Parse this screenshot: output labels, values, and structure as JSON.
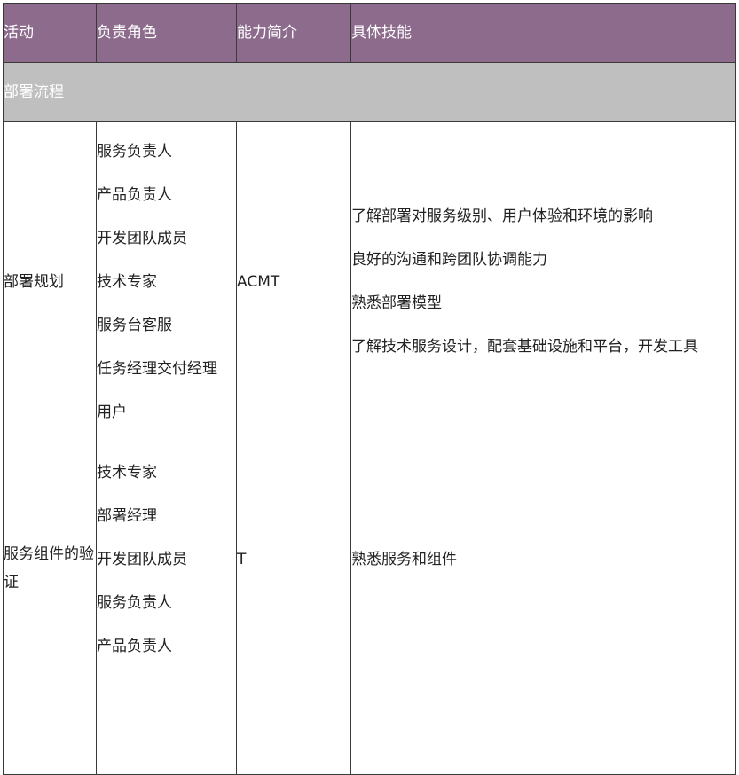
{
  "table": {
    "headers": [
      "活动",
      "负责角色",
      "能力简介",
      "具体技能"
    ],
    "section": "部署流程",
    "rows": [
      {
        "activity": "部署规划",
        "roles": [
          "服务负责人",
          "产品负责人",
          "开发团队成员",
          "技术专家",
          "服务台客服",
          "任务经理交付经理",
          "用户"
        ],
        "competency": "ACMT",
        "skills": [
          "了解部署对服务级别、用户体验和环境的影响",
          "良好的沟通和跨团队协调能力",
          "熟悉部署模型",
          "了解技术服务设计，配套基础设施和平台，开发工具"
        ]
      },
      {
        "activity": "服务组件的验证",
        "roles": [
          "技术专家",
          "部署经理",
          "开发团队成员",
          "服务负责人",
          "产品负责人"
        ],
        "competency": "T",
        "skills": [
          "熟悉服务和组件"
        ]
      }
    ]
  }
}
